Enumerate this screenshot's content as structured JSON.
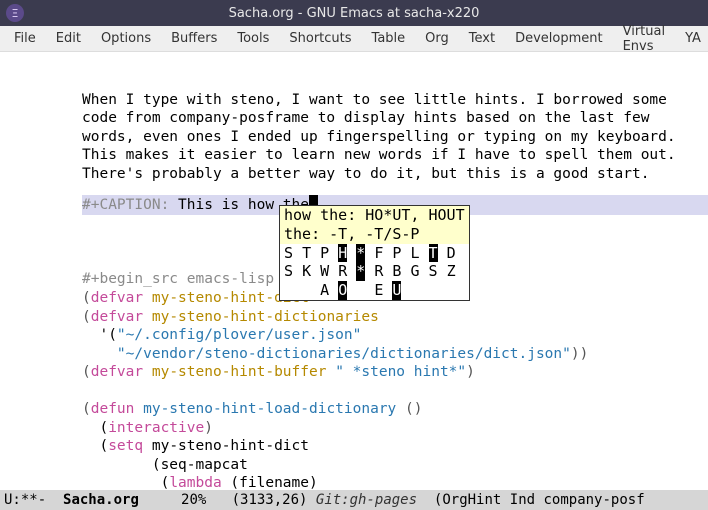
{
  "window": {
    "title": "Sacha.org - GNU Emacs at sacha-x220",
    "app_icon_glyph": "Ξ"
  },
  "menu": {
    "items": [
      "File",
      "Edit",
      "Options",
      "Buffers",
      "Tools",
      "Shortcuts",
      "Table",
      "Org",
      "Text",
      "Development",
      "Virtual Envs",
      "YA"
    ]
  },
  "body_text": {
    "p1": "When I type with steno, I want to see little hints. I borrowed some",
    "p2": "code from company-posframe to display hints based on the last few",
    "p3": "words, even ones I ended up fingerspelling or typing on my keyboard.",
    "p4": "This makes it easier to learn new words if I have to spell them out.",
    "p5": "There's probably a better way to do it, but this is a good start."
  },
  "caption": {
    "keyword": "#+CAPTION:",
    "text": " This is how the"
  },
  "popup": {
    "hint1": "how the: HO*UT, HOUT",
    "hint2": "the: -T, -T/S-P",
    "row1": {
      "c1": "S",
      "c2": "T",
      "c3": "P",
      "c4": "H",
      "star": "*",
      "c5": "F",
      "c6": "P",
      "c7": "L",
      "c8": "T",
      "c9": "D"
    },
    "row2": {
      "c1": "S",
      "c2": "K",
      "c3": "W",
      "c4": "R",
      "star": "*",
      "c5": "R",
      "c6": "B",
      "c7": "G",
      "c8": "S",
      "c9": "Z"
    },
    "row3": {
      "a": "A",
      "o": "O",
      "e": "E",
      "u": "U"
    }
  },
  "code": {
    "begin_src": "#+begin_src emacs-lisp",
    "l1_open": "(",
    "l1_defvar": "defvar",
    "l1_var": " my-steno-hint-dict",
    "l1_close": "",
    "l2_open": "(",
    "l2_defvar": "defvar",
    "l2_var": " my-steno-hint-dictionaries",
    "l3_lead": "  '(",
    "l3_str": "\"~/.config/plover/user.json\"",
    "l4_lead": "    ",
    "l4_str": "\"~/vendor/steno-dictionaries/dictionaries/dict.json\"",
    "l4_close": "))",
    "l5_open": "(",
    "l5_defvar": "defvar",
    "l5_var": " my-steno-hint-buffer ",
    "l5_str": "\" *steno hint*\"",
    "l5_close": ")",
    "l7_open": "(",
    "l7_defun": "defun",
    "l7_fn": " my-steno-hint-load-dictionary ",
    "l7_args": "()",
    "l8_lead": "  (",
    "l8_kw": "interactive",
    "l8_close": ")",
    "l9_lead": "  (",
    "l9_kw": "setq",
    "l9_var": " my-steno-hint-dict",
    "l10_lead": "        (seq-mapcat",
    "l11_lead": "         (",
    "l11_kw": "lambda",
    "l11_args": " (filename)"
  },
  "modeline": {
    "left": "U:**-  ",
    "filename": "Sacha.org",
    "pct": "     20%   ",
    "pos": "(3133,26) ",
    "vc": "Git:gh-pages",
    "modes": "  (OrgHint Ind company-posf"
  }
}
